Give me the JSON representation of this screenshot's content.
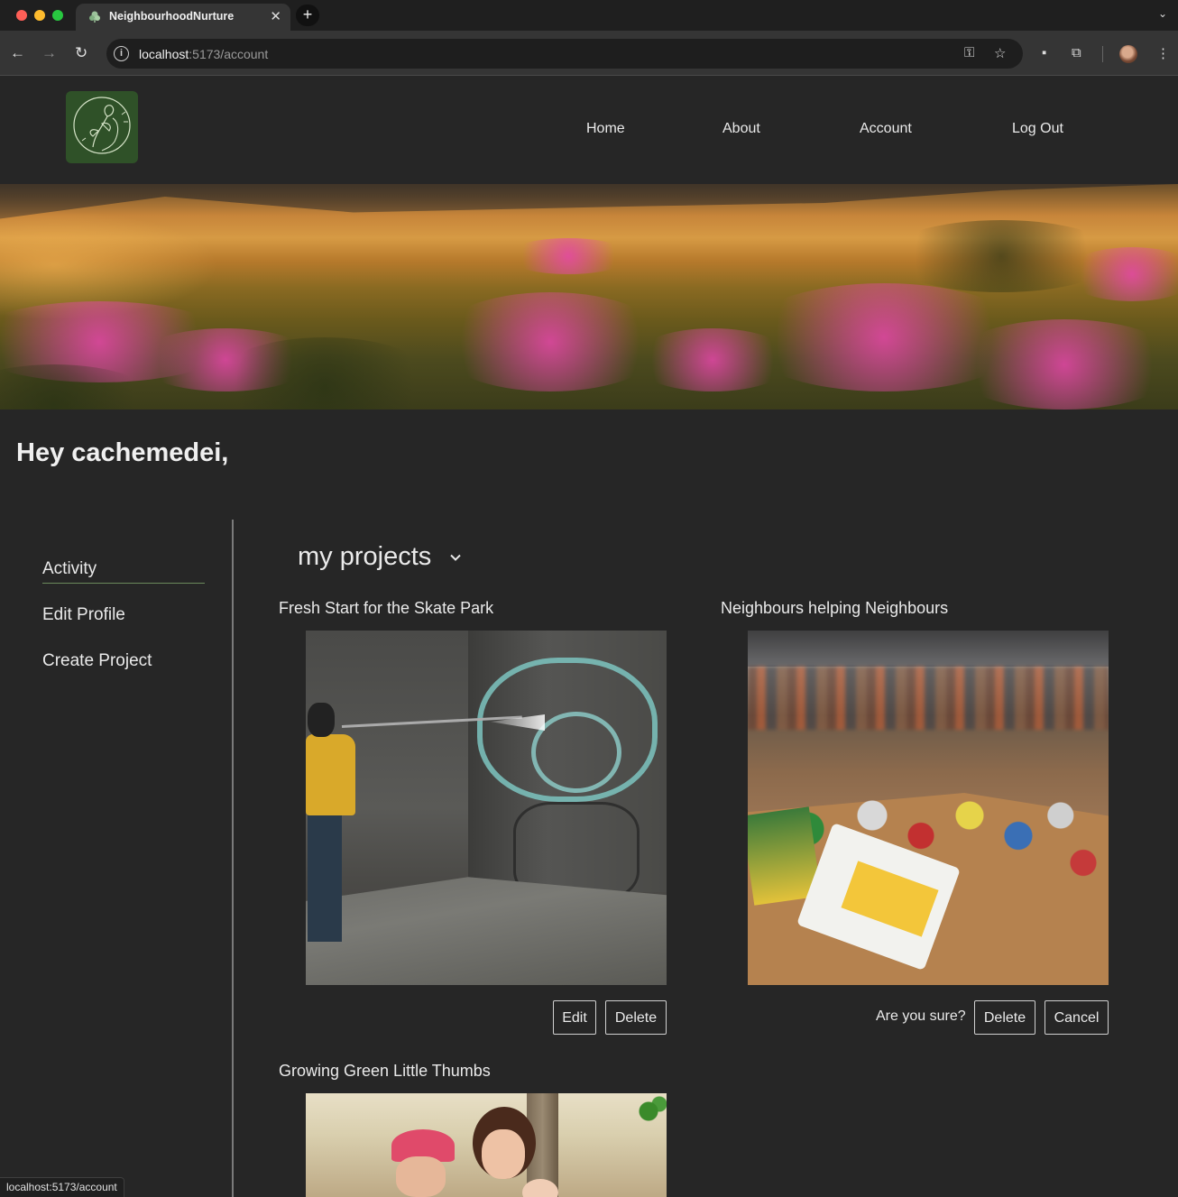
{
  "browser": {
    "tab_title": "NeighbourhoodNurture",
    "new_tab": "+",
    "url_host": "localhost",
    "url_path": ":5173/account",
    "status_bar_url": "localhost:5173/account"
  },
  "nav": {
    "home": "Home",
    "about": "About",
    "account": "Account",
    "logout": "Log Out"
  },
  "greeting": "Hey cachemedei,",
  "sidebar": {
    "items": [
      {
        "label": "Activity"
      },
      {
        "label": "Edit Profile"
      },
      {
        "label": "Create Project"
      }
    ]
  },
  "main": {
    "section_title": "my projects",
    "projects": [
      {
        "title": "Fresh Start for the Skate Park",
        "image": "pressure-washing-graffiti-wall"
      },
      {
        "title": "Neighbours helping Neighbours",
        "image": "food-drive-donation-box"
      },
      {
        "title": "Growing Green Little Thumbs",
        "image": "gardening-with-children"
      }
    ],
    "edit_label": "Edit",
    "delete_label": "Delete",
    "confirm_text": "Are you sure?",
    "cancel_label": "Cancel"
  },
  "colors": {
    "background": "#262626",
    "logo_green": "#2f5128",
    "accent_underline": "#6b8a5c"
  }
}
